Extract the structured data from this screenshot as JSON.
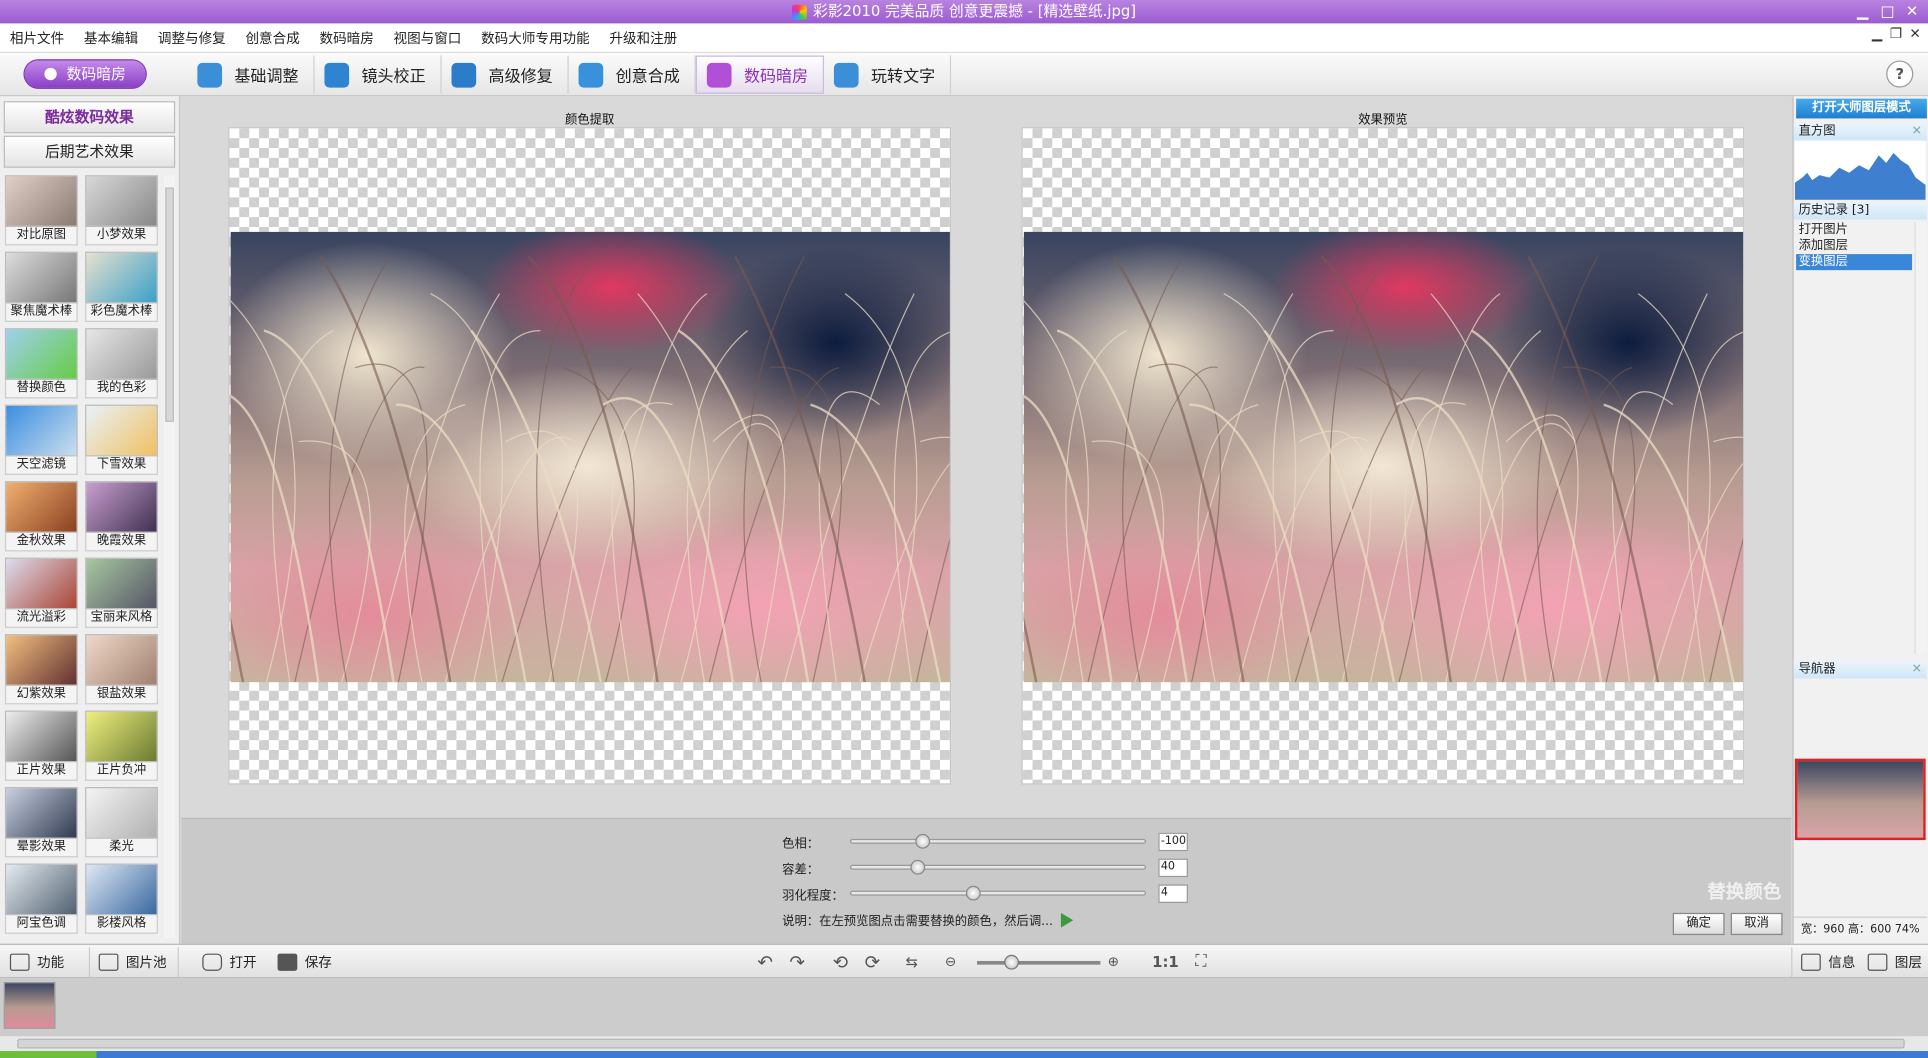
{
  "title": "彩影2010 完美品质 创意更震撼 - [精选壁纸.jpg]",
  "menu": [
    "相片文件",
    "基本编辑",
    "调整与修复",
    "创意合成",
    "数码暗房",
    "视图与窗口",
    "数码大师专用功能",
    "升级和注册"
  ],
  "mode_button": "数码暗房",
  "tabs": [
    {
      "label": "基础调整",
      "color": "#3a8fd8"
    },
    {
      "label": "镜头校正",
      "color": "#2f84d1"
    },
    {
      "label": "高级修复",
      "color": "#2b7cc9"
    },
    {
      "label": "创意合成",
      "color": "#3990db"
    },
    {
      "label": "数码暗房",
      "color": "#b14fd6"
    },
    {
      "label": "玩转文字",
      "color": "#3a8fd8"
    }
  ],
  "active_tab": "数码暗房",
  "help": "?",
  "left": {
    "btn1": "酷炫数码效果",
    "btn2": "后期艺术效果",
    "effects": [
      {
        "label": "对比原图",
        "c1": "#e0d0c8",
        "c2": "#8a7a70"
      },
      {
        "label": "小梦效果",
        "c1": "#d8d8d8",
        "c2": "#888"
      },
      {
        "label": "聚焦魔术棒",
        "c1": "#ddd",
        "c2": "#777"
      },
      {
        "label": "彩色魔术棒",
        "c1": "#e6e0d0",
        "c2": "#3aa0c8"
      },
      {
        "label": "替换颜色",
        "c1": "#9fd0ee",
        "c2": "#6c4"
      },
      {
        "label": "我的色彩",
        "c1": "#e6e6e6",
        "c2": "#999"
      },
      {
        "label": "天空滤镜",
        "c1": "#3a8fe0",
        "c2": "#cde"
      },
      {
        "label": "下雪效果",
        "c1": "#e8f2fa",
        "c2": "#f0c060"
      },
      {
        "label": "金秋效果",
        "c1": "#f0b070",
        "c2": "#8a4020"
      },
      {
        "label": "晚霞效果",
        "c1": "#c8a0d0",
        "c2": "#403050"
      },
      {
        "label": "流光溢彩",
        "c1": "#dde",
        "c2": "#a43"
      },
      {
        "label": "宝丽来风格",
        "c1": "#a8c8a0",
        "c2": "#556"
      },
      {
        "label": "幻紫效果",
        "c1": "#f3c080",
        "c2": "#603030"
      },
      {
        "label": "银盐效果",
        "c1": "#f0d8c8",
        "c2": "#a08070"
      },
      {
        "label": "正片效果",
        "c1": "#eee",
        "c2": "#555"
      },
      {
        "label": "正片负冲",
        "c1": "#f0f080",
        "c2": "#6a7a30"
      },
      {
        "label": "晕影效果",
        "c1": "#c8d0e0",
        "c2": "#303a50"
      },
      {
        "label": "柔光",
        "c1": "#f4f4f4",
        "c2": "#b0b0b0"
      },
      {
        "label": "阿宝色调",
        "c1": "#e4eaf0",
        "c2": "#506070"
      },
      {
        "label": "影楼风格",
        "c1": "#dfe8f4",
        "c2": "#3868a0"
      }
    ]
  },
  "panels": {
    "left_title": "颜色提取",
    "right_title": "效果预览"
  },
  "controls": {
    "rows": [
      {
        "label": "色相：",
        "value": "-100",
        "pos": 0.23
      },
      {
        "label": "容差：",
        "value": "40",
        "pos": 0.21
      },
      {
        "label": "羽化程度：",
        "value": "4",
        "pos": 0.41
      }
    ],
    "desc": "说明：在左预览图点击需要替换的颜色，然后调...",
    "watermark": "替换颜色",
    "ok": "确定",
    "cancel": "取消"
  },
  "right": {
    "master": "打开大师图层模式",
    "hist": "直方图",
    "history": "历史记录 [3]",
    "items": [
      "打开图片",
      "添加图层",
      "变换图层"
    ],
    "selected": 2,
    "navigator": "导航器",
    "dims": "宽：960 高：600 74%"
  },
  "bottom": {
    "func": "功能",
    "pool": "图片池",
    "open": "打开",
    "save": "保存",
    "ratio": "1:1",
    "info": "信息",
    "layers": "图层"
  }
}
